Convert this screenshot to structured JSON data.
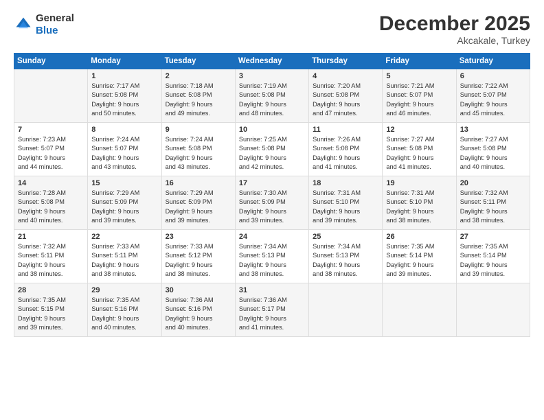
{
  "logo": {
    "general": "General",
    "blue": "Blue"
  },
  "title": "December 2025",
  "subtitle": "Akcakale, Turkey",
  "days_header": [
    "Sunday",
    "Monday",
    "Tuesday",
    "Wednesday",
    "Thursday",
    "Friday",
    "Saturday"
  ],
  "weeks": [
    [
      {
        "num": "",
        "lines": []
      },
      {
        "num": "1",
        "lines": [
          "Sunrise: 7:17 AM",
          "Sunset: 5:08 PM",
          "Daylight: 9 hours",
          "and 50 minutes."
        ]
      },
      {
        "num": "2",
        "lines": [
          "Sunrise: 7:18 AM",
          "Sunset: 5:08 PM",
          "Daylight: 9 hours",
          "and 49 minutes."
        ]
      },
      {
        "num": "3",
        "lines": [
          "Sunrise: 7:19 AM",
          "Sunset: 5:08 PM",
          "Daylight: 9 hours",
          "and 48 minutes."
        ]
      },
      {
        "num": "4",
        "lines": [
          "Sunrise: 7:20 AM",
          "Sunset: 5:08 PM",
          "Daylight: 9 hours",
          "and 47 minutes."
        ]
      },
      {
        "num": "5",
        "lines": [
          "Sunrise: 7:21 AM",
          "Sunset: 5:07 PM",
          "Daylight: 9 hours",
          "and 46 minutes."
        ]
      },
      {
        "num": "6",
        "lines": [
          "Sunrise: 7:22 AM",
          "Sunset: 5:07 PM",
          "Daylight: 9 hours",
          "and 45 minutes."
        ]
      }
    ],
    [
      {
        "num": "7",
        "lines": [
          "Sunrise: 7:23 AM",
          "Sunset: 5:07 PM",
          "Daylight: 9 hours",
          "and 44 minutes."
        ]
      },
      {
        "num": "8",
        "lines": [
          "Sunrise: 7:24 AM",
          "Sunset: 5:07 PM",
          "Daylight: 9 hours",
          "and 43 minutes."
        ]
      },
      {
        "num": "9",
        "lines": [
          "Sunrise: 7:24 AM",
          "Sunset: 5:08 PM",
          "Daylight: 9 hours",
          "and 43 minutes."
        ]
      },
      {
        "num": "10",
        "lines": [
          "Sunrise: 7:25 AM",
          "Sunset: 5:08 PM",
          "Daylight: 9 hours",
          "and 42 minutes."
        ]
      },
      {
        "num": "11",
        "lines": [
          "Sunrise: 7:26 AM",
          "Sunset: 5:08 PM",
          "Daylight: 9 hours",
          "and 41 minutes."
        ]
      },
      {
        "num": "12",
        "lines": [
          "Sunrise: 7:27 AM",
          "Sunset: 5:08 PM",
          "Daylight: 9 hours",
          "and 41 minutes."
        ]
      },
      {
        "num": "13",
        "lines": [
          "Sunrise: 7:27 AM",
          "Sunset: 5:08 PM",
          "Daylight: 9 hours",
          "and 40 minutes."
        ]
      }
    ],
    [
      {
        "num": "14",
        "lines": [
          "Sunrise: 7:28 AM",
          "Sunset: 5:08 PM",
          "Daylight: 9 hours",
          "and 40 minutes."
        ]
      },
      {
        "num": "15",
        "lines": [
          "Sunrise: 7:29 AM",
          "Sunset: 5:09 PM",
          "Daylight: 9 hours",
          "and 39 minutes."
        ]
      },
      {
        "num": "16",
        "lines": [
          "Sunrise: 7:29 AM",
          "Sunset: 5:09 PM",
          "Daylight: 9 hours",
          "and 39 minutes."
        ]
      },
      {
        "num": "17",
        "lines": [
          "Sunrise: 7:30 AM",
          "Sunset: 5:09 PM",
          "Daylight: 9 hours",
          "and 39 minutes."
        ]
      },
      {
        "num": "18",
        "lines": [
          "Sunrise: 7:31 AM",
          "Sunset: 5:10 PM",
          "Daylight: 9 hours",
          "and 39 minutes."
        ]
      },
      {
        "num": "19",
        "lines": [
          "Sunrise: 7:31 AM",
          "Sunset: 5:10 PM",
          "Daylight: 9 hours",
          "and 38 minutes."
        ]
      },
      {
        "num": "20",
        "lines": [
          "Sunrise: 7:32 AM",
          "Sunset: 5:11 PM",
          "Daylight: 9 hours",
          "and 38 minutes."
        ]
      }
    ],
    [
      {
        "num": "21",
        "lines": [
          "Sunrise: 7:32 AM",
          "Sunset: 5:11 PM",
          "Daylight: 9 hours",
          "and 38 minutes."
        ]
      },
      {
        "num": "22",
        "lines": [
          "Sunrise: 7:33 AM",
          "Sunset: 5:11 PM",
          "Daylight: 9 hours",
          "and 38 minutes."
        ]
      },
      {
        "num": "23",
        "lines": [
          "Sunrise: 7:33 AM",
          "Sunset: 5:12 PM",
          "Daylight: 9 hours",
          "and 38 minutes."
        ]
      },
      {
        "num": "24",
        "lines": [
          "Sunrise: 7:34 AM",
          "Sunset: 5:13 PM",
          "Daylight: 9 hours",
          "and 38 minutes."
        ]
      },
      {
        "num": "25",
        "lines": [
          "Sunrise: 7:34 AM",
          "Sunset: 5:13 PM",
          "Daylight: 9 hours",
          "and 38 minutes."
        ]
      },
      {
        "num": "26",
        "lines": [
          "Sunrise: 7:35 AM",
          "Sunset: 5:14 PM",
          "Daylight: 9 hours",
          "and 39 minutes."
        ]
      },
      {
        "num": "27",
        "lines": [
          "Sunrise: 7:35 AM",
          "Sunset: 5:14 PM",
          "Daylight: 9 hours",
          "and 39 minutes."
        ]
      }
    ],
    [
      {
        "num": "28",
        "lines": [
          "Sunrise: 7:35 AM",
          "Sunset: 5:15 PM",
          "Daylight: 9 hours",
          "and 39 minutes."
        ]
      },
      {
        "num": "29",
        "lines": [
          "Sunrise: 7:35 AM",
          "Sunset: 5:16 PM",
          "Daylight: 9 hours",
          "and 40 minutes."
        ]
      },
      {
        "num": "30",
        "lines": [
          "Sunrise: 7:36 AM",
          "Sunset: 5:16 PM",
          "Daylight: 9 hours",
          "and 40 minutes."
        ]
      },
      {
        "num": "31",
        "lines": [
          "Sunrise: 7:36 AM",
          "Sunset: 5:17 PM",
          "Daylight: 9 hours",
          "and 41 minutes."
        ]
      },
      {
        "num": "",
        "lines": []
      },
      {
        "num": "",
        "lines": []
      },
      {
        "num": "",
        "lines": []
      }
    ]
  ]
}
